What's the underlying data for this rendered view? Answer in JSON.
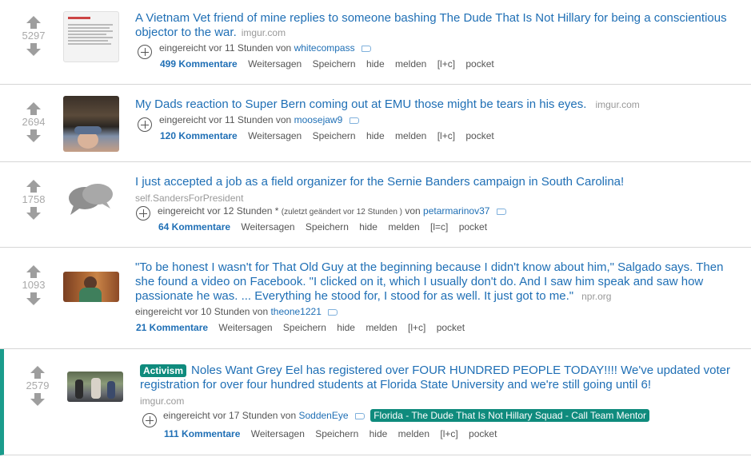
{
  "posts": [
    {
      "score": "5297",
      "title": "A Vietnam Vet friend of mine replies to someone bashing The Dude That Is Not Hillary for being a conscientious objector to the war.",
      "domain": "imgur.com",
      "submitted": "eingereicht vor 11 Stunden von",
      "author": "whitecompass",
      "comments": "499 Kommentare"
    },
    {
      "score": "2694",
      "title": "My Dads reaction to Super Bern coming out at EMU those might be tears in his eyes.",
      "domain": "imgur.com",
      "submitted": "eingereicht vor 11 Stunden von",
      "author": "moosejaw9",
      "comments": "120 Kommentare"
    },
    {
      "score": "1758",
      "title": "I just accepted a job as a field organizer for the Sernie Banders campaign in South Carolina!",
      "domain": "self.SandersForPresident",
      "submitted": "eingereicht vor 12 Stunden *",
      "edited": "(zuletzt geändert vor 12 Stunden )",
      "von": "von",
      "author": "petarmarinov37",
      "comments": "64 Kommentare"
    },
    {
      "score": "1093",
      "title": "\"To be honest I wasn't for That Old Guy at the beginning because I didn't know about him,\" Salgado says. Then she found a video on Facebook. \"I clicked on it, which I usually don't do. And I saw him speak and saw how passionate he was. ... Everything he stood for, I stood for as well. It just got to me.\"",
      "domain": "npr.org",
      "submitted": "eingereicht vor 10 Stunden von",
      "author": "theone1221",
      "comments": "21 Kommentare"
    },
    {
      "score": "2579",
      "flair": "Activism",
      "title": "Noles Want Grey Eel has registered over FOUR HUNDRED PEOPLE TODAY!!!! We've updated voter registration for over four hundred students at Florida State University and we're still going until 6!",
      "domain": "imgur.com",
      "submitted": "eingereicht vor 17 Stunden von",
      "author": "SoddenEye",
      "user_flair": "Florida - The Dude That Is Not Hillary Squad - Call Team Mentor",
      "comments": "111 Kommentare"
    }
  ],
  "actions": {
    "share": "Weitersagen",
    "save": "Speichern",
    "hide": "hide",
    "report": "melden",
    "lc": "[l+c]",
    "pocket": "pocket"
  },
  "colors": {
    "link": "#1f6fb5",
    "accent": "#0f8b7d",
    "selected_bar": "#1a9c8c"
  }
}
